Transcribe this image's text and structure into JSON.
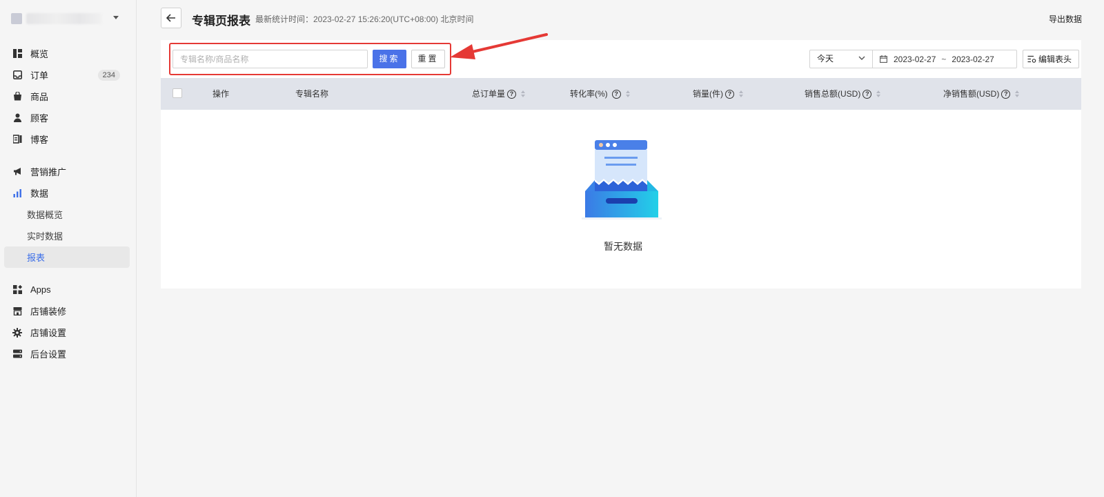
{
  "sidebar": {
    "items": [
      {
        "label": "概览",
        "icon": "overview-icon"
      },
      {
        "label": "订单",
        "icon": "inbox-icon",
        "badge": "234"
      },
      {
        "label": "商品",
        "icon": "bag-icon"
      },
      {
        "label": "顾客",
        "icon": "person-icon"
      },
      {
        "label": "博客",
        "icon": "blog-icon"
      },
      {
        "label": "营销推广",
        "icon": "megaphone-icon"
      },
      {
        "label": "数据",
        "icon": "bar-chart-icon"
      },
      {
        "label": "数据概览"
      },
      {
        "label": "实时数据"
      },
      {
        "label": "报表"
      },
      {
        "label": "Apps",
        "icon": "apps-icon"
      },
      {
        "label": "店铺装修",
        "icon": "storefront-icon"
      },
      {
        "label": "店铺设置",
        "icon": "gear-icon"
      },
      {
        "label": "后台设置",
        "icon": "server-icon"
      }
    ]
  },
  "header": {
    "title": "专辑页报表",
    "stat_time": "最新统计时间：2023-02-27 15:26:20(UTC+08:00) 北京时间",
    "export_label": "导出数据"
  },
  "filters": {
    "search_placeholder": "专辑名称/商品名称",
    "search_label": "搜索",
    "reset_label": "重置",
    "period": "今天",
    "date_start": "2023-02-27",
    "date_sep": "~",
    "date_end": "2023-02-27",
    "edit_header_label": "编辑表头"
  },
  "table": {
    "columns": [
      "操作",
      "专辑名称",
      "总订单量",
      "转化率(%)",
      "销量(件)",
      "销售总额(USD)",
      "净销售额(USD)"
    ],
    "empty_text": "暂无数据"
  },
  "colors": {
    "accent": "#4a72e8",
    "highlight": "#e53935",
    "table_header_bg": "#e0e3ea"
  }
}
